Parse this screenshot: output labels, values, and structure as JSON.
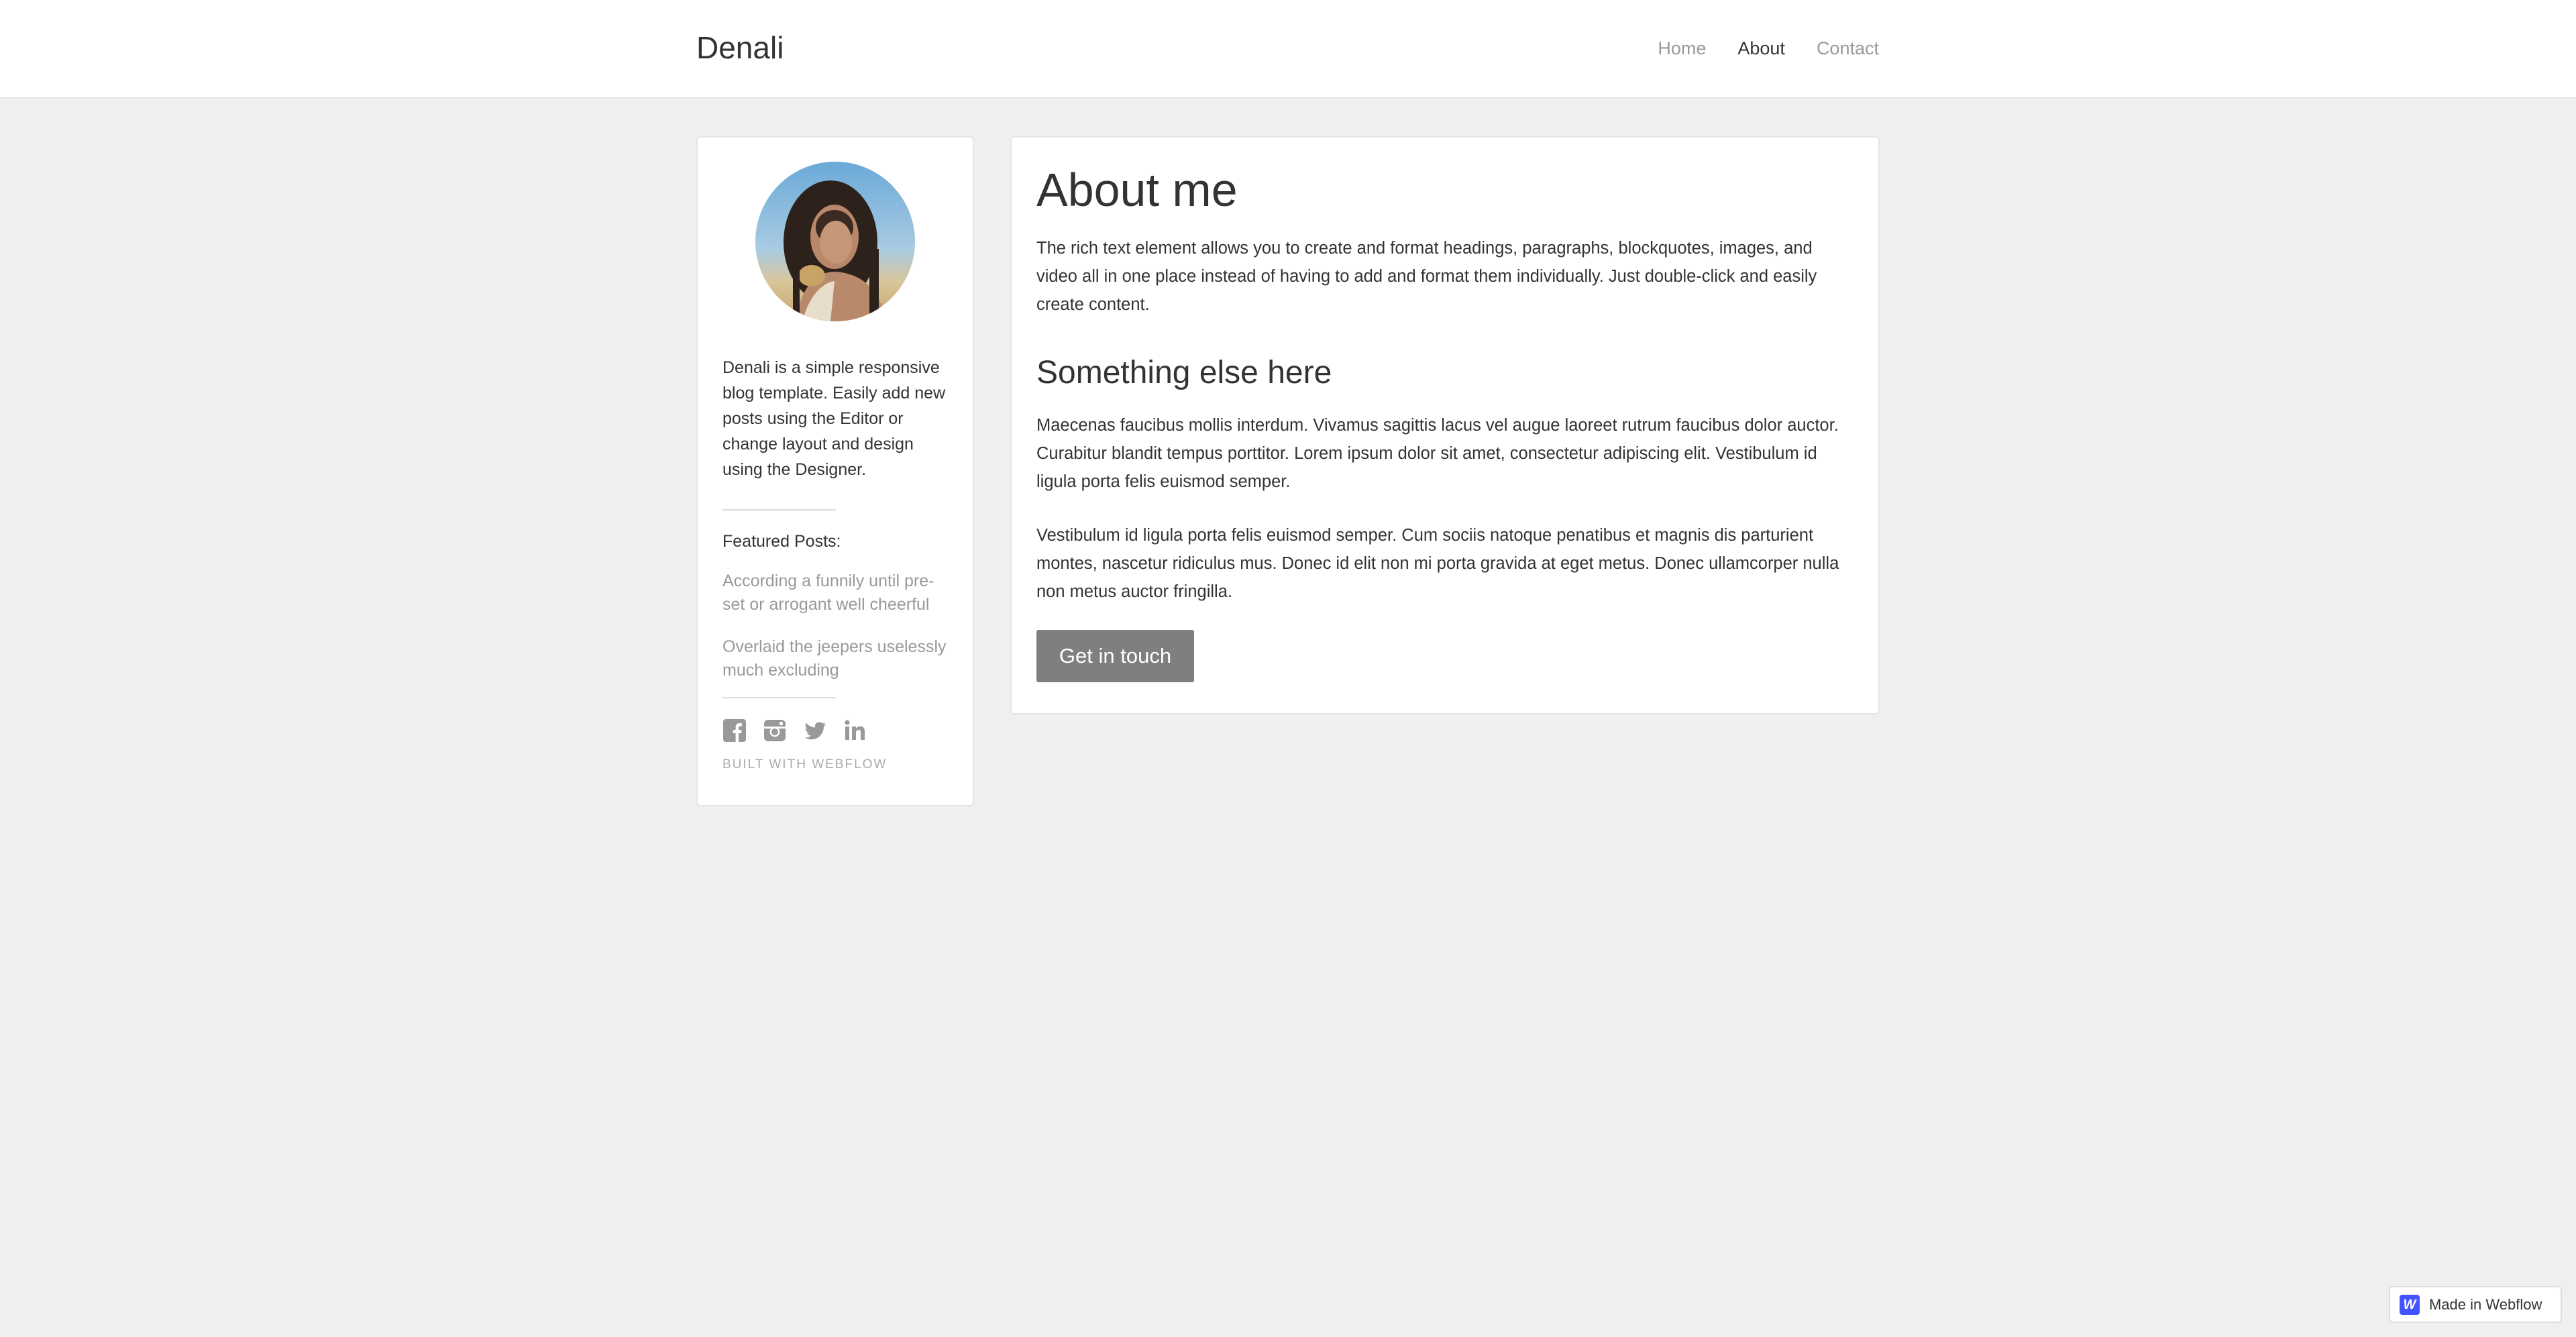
{
  "header": {
    "brand": "Denali",
    "nav": [
      {
        "label": "Home",
        "active": false
      },
      {
        "label": "About",
        "active": true
      },
      {
        "label": "Contact",
        "active": false
      }
    ]
  },
  "sidebar": {
    "bio": "Denali is a simple responsive blog template. Easily add new posts using the Editor or change layout and design using the Designer.",
    "featured_title": "Featured Posts:",
    "featured_posts": [
      "According a funnily until pre-set or arrogant well cheerful",
      "Overlaid the jeepers uselessly much excluding"
    ],
    "social_icons": [
      "facebook-icon",
      "instagram-icon",
      "twitter-icon",
      "linkedin-icon"
    ],
    "built_with": "BUILT WITH WEBFLOW"
  },
  "main": {
    "title": "About me",
    "intro": "The rich text element allows you to create and format headings, paragraphs, blockquotes, images, and video all in one place instead of having to add and format them individually. Just double-click and easily create content.",
    "section_title": "Something else here",
    "paragraph_1": "Maecenas faucibus mollis interdum. Vivamus sagittis lacus vel augue laoreet rutrum faucibus dolor auctor. Curabitur blandit tempus porttitor. Lorem ipsum dolor sit amet, consectetur adipiscing elit. Vestibulum id ligula porta felis euismod semper.",
    "paragraph_2": "Vestibulum id ligula porta felis euismod semper. Cum sociis natoque penatibus et magnis dis parturient montes, nascetur ridiculus mus. Donec id elit non mi porta gravida at eget metus. Donec ullamcorper nulla non metus auctor fringilla.",
    "button_label": "Get in touch"
  },
  "badge": {
    "logo": "W",
    "label": "Made in Webflow"
  },
  "colors": {
    "background": "#efefef",
    "card": "#ffffff",
    "button": "#7f7f7f",
    "muted_link": "#999999",
    "webflow_blue": "#4353ff"
  }
}
